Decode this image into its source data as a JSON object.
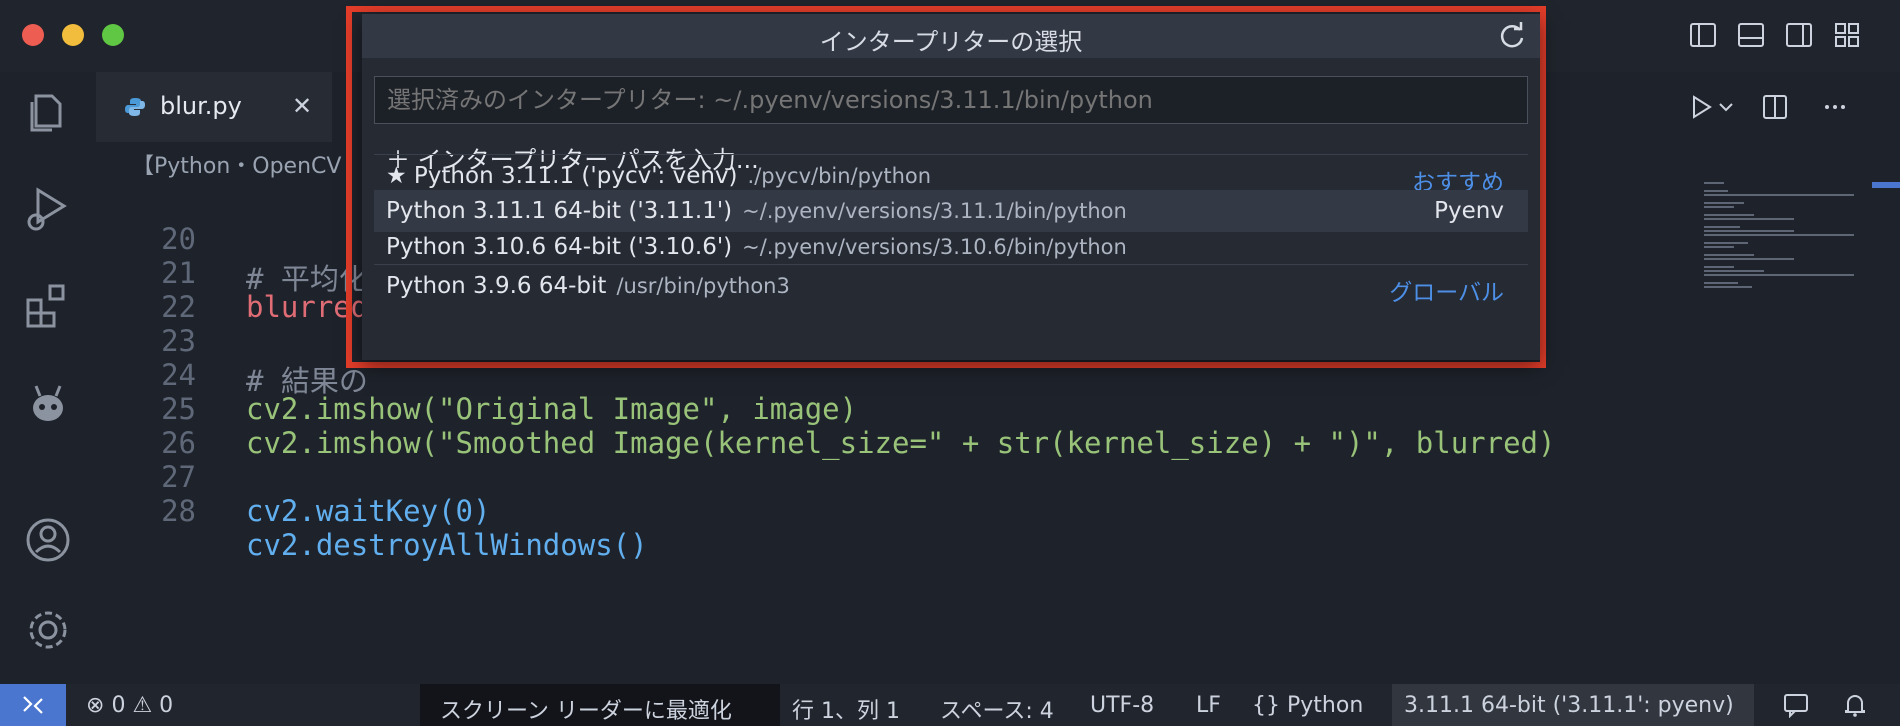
{
  "colors": {
    "accent_blue": "#4a76d0",
    "highlight_red": "#e43d2a",
    "editor_bg": "#1e222a"
  },
  "tab": {
    "filename": "blur.py",
    "close_glyph": "✕"
  },
  "breadcrumb": "【Python・OpenCV",
  "code_lines": [
    {
      "num": "20",
      "text": "# 平均化"
    },
    {
      "num": "21",
      "text": "blurred"
    },
    {
      "num": "22",
      "text": ""
    },
    {
      "num": "23",
      "text": "# 結果の"
    },
    {
      "num": "24",
      "text": "cv2.imshow(\"Original Image\", image)"
    },
    {
      "num": "25",
      "text": "cv2.imshow(\"Smoothed Image(kernel_size=\" + str(kernel_size) + \")\", blurred)"
    },
    {
      "num": "26",
      "text": ""
    },
    {
      "num": "27",
      "text": "cv2.waitKey(0)"
    },
    {
      "num": "28",
      "text": "cv2.destroyAllWindows()"
    }
  ],
  "quick_pick": {
    "title": "インタープリターの選択",
    "placeholder": "選択済みのインタープリター: ~/.pyenv/versions/3.11.1/bin/python",
    "enter_path": "＋ インタープリター パスを入力...",
    "items": [
      {
        "label": "★ Python 3.11.1 ('pycv': venv)",
        "desc": "./pycv/bin/python",
        "badge": "おすすめ"
      },
      {
        "label": "Python 3.11.1 64-bit ('3.11.1')",
        "desc": "~/.pyenv/versions/3.11.1/bin/python",
        "badge": "Pyenv"
      },
      {
        "label": "Python 3.10.6 64-bit ('3.10.6')",
        "desc": "~/.pyenv/versions/3.10.6/bin/python",
        "badge": ""
      },
      {
        "label": "Python 3.9.6 64-bit",
        "desc": "/usr/bin/python3",
        "badge": "グローバル"
      }
    ]
  },
  "status": {
    "errors": "0",
    "warnings": "0",
    "screen_reader": "スクリーン リーダーに最適化",
    "position": "行 1、列 1",
    "spaces": "スペース: 4",
    "encoding": "UTF-8",
    "eol": "LF",
    "language": "Python",
    "interpreter": "3.11.1 64-bit ('3.11.1': pyenv)"
  }
}
